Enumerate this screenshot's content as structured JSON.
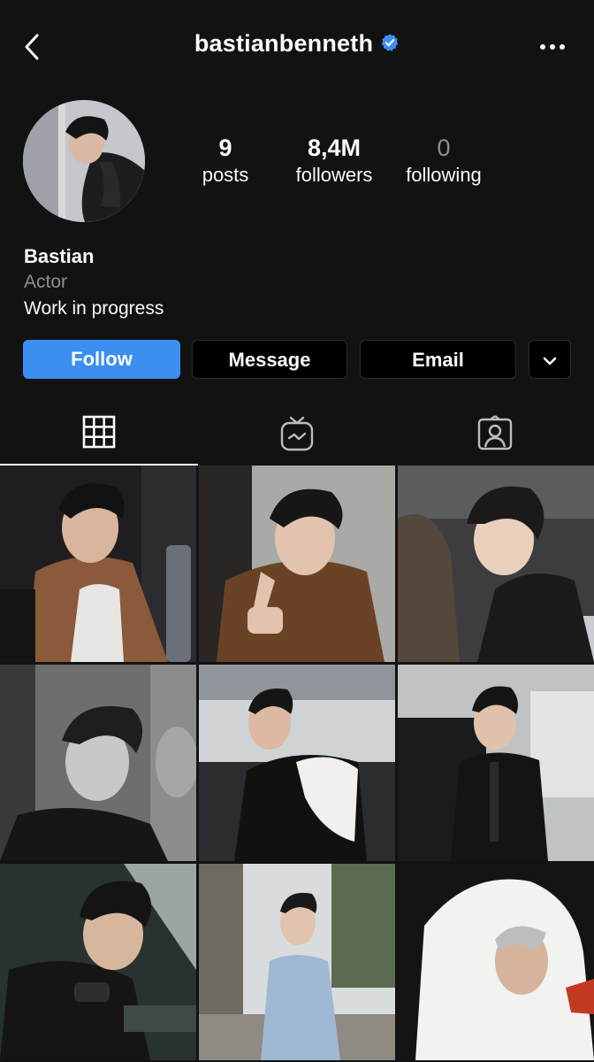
{
  "header": {
    "username": "bastianbenneth",
    "back_icon": "chevron-left-icon",
    "verified_icon": "verified-badge-icon",
    "more_icon": "more-horizontal-icon"
  },
  "profile": {
    "avatar_icon": "profile-photo",
    "stats": [
      {
        "value": "9",
        "label": "posts"
      },
      {
        "value": "8,4M",
        "label": "followers"
      },
      {
        "value": "0",
        "label": "following"
      }
    ],
    "name": "Bastian",
    "category": "Actor",
    "bio": "Work in progress"
  },
  "actions": {
    "follow": "Follow",
    "message": "Message",
    "email": "Email",
    "dropdown_icon": "chevron-down-icon"
  },
  "tabs": [
    {
      "icon": "grid-icon",
      "active": true
    },
    {
      "icon": "igtv-icon",
      "active": false
    },
    {
      "icon": "tagged-person-icon",
      "active": false
    }
  ],
  "posts": [
    {
      "id": "post-1",
      "tone": "dark-brown-jacket"
    },
    {
      "id": "post-2",
      "tone": "brown-jacket-peace-sign"
    },
    {
      "id": "post-3",
      "tone": "black-leather-car"
    },
    {
      "id": "post-4",
      "tone": "black-and-white-mirror"
    },
    {
      "id": "post-5",
      "tone": "backless-shirt-event"
    },
    {
      "id": "post-6",
      "tone": "black-suit-car"
    },
    {
      "id": "post-7",
      "tone": "sunglasses-closeup"
    },
    {
      "id": "post-8",
      "tone": "denim-jacket-street"
    },
    {
      "id": "post-9",
      "tone": "white-hoodie"
    }
  ],
  "colors": {
    "background": "#121212",
    "follow_button": "#3b8ff0",
    "verified": "#3b8ff0",
    "secondary_text": "#8e8e8e"
  }
}
